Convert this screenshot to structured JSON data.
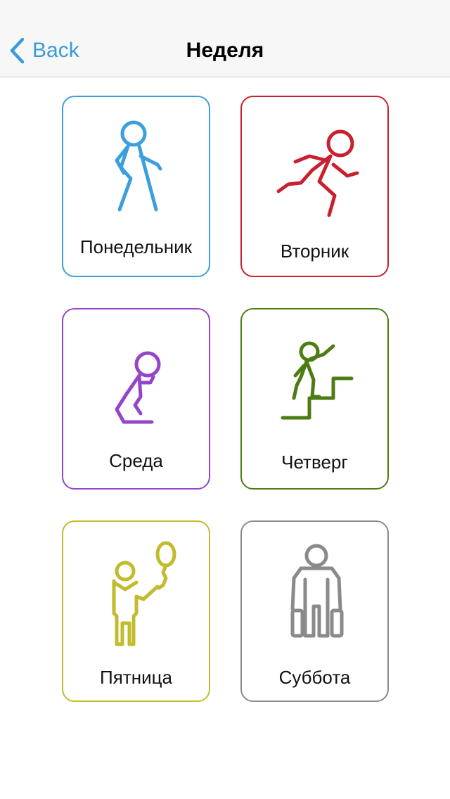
{
  "nav": {
    "back_label": "Back",
    "title": "Неделя"
  },
  "days": [
    {
      "label": "Понедельник",
      "color": "#3b9fdc",
      "icon": "walking-person-icon"
    },
    {
      "label": "Вторник",
      "color": "#c8202e",
      "icon": "running-person-icon"
    },
    {
      "label": "Среда",
      "color": "#9546c8",
      "icon": "kneeling-person-icon"
    },
    {
      "label": "Четверг",
      "color": "#4d7c13",
      "icon": "climbing-stairs-icon"
    },
    {
      "label": "Пятница",
      "color": "#c2bb2d",
      "icon": "person-with-balloon-icon"
    },
    {
      "label": "Суббота",
      "color": "#8a8a8a",
      "icon": "traveler-with-luggage-icon"
    }
  ]
}
